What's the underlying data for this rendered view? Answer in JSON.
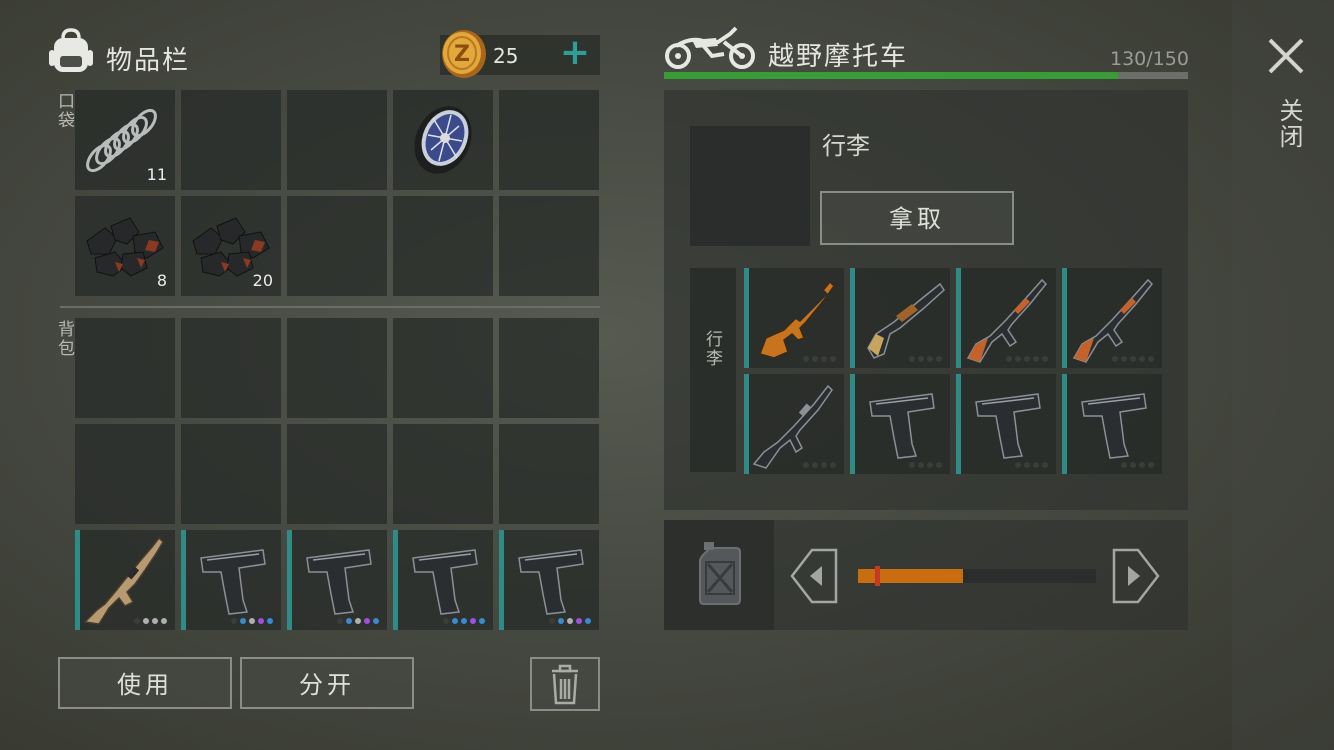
{
  "inventory": {
    "title": "物品栏",
    "coins": "25",
    "add_label": "+",
    "pocket_label": "口袋",
    "backpack_label": "背包",
    "pocket_slots": [
      {
        "icon": "spring-icon",
        "count": "11"
      },
      {
        "icon": "",
        "count": ""
      },
      {
        "icon": "",
        "count": ""
      },
      {
        "icon": "wheel-icon",
        "count": ""
      },
      {
        "icon": "",
        "count": ""
      },
      {
        "icon": "coal-icon",
        "count": "8"
      },
      {
        "icon": "coal-icon",
        "count": "20"
      },
      {
        "icon": "",
        "count": ""
      },
      {
        "icon": "",
        "count": ""
      },
      {
        "icon": "",
        "count": ""
      }
    ],
    "hotbar": [
      {
        "icon": "rifle-scar-icon",
        "dots": [
          "#3a3d3a",
          "#b0b0b0",
          "#b0b0b0",
          "#b0b0b0"
        ]
      },
      {
        "icon": "pistol-icon",
        "dots": [
          "#3a3d3a",
          "#3a8ad0",
          "#b0b0b0",
          "#a050e0",
          "#3a8ad0"
        ]
      },
      {
        "icon": "pistol-icon",
        "dots": [
          "#3a3d3a",
          "#3a8ad0",
          "#b0b0b0",
          "#a050e0",
          "#3a8ad0"
        ]
      },
      {
        "icon": "pistol-icon",
        "dots": [
          "#3a3d3a",
          "#3a8ad0",
          "#3a8ad0",
          "#a050e0",
          "#3a8ad0"
        ]
      },
      {
        "icon": "pistol-icon",
        "dots": [
          "#3a3d3a",
          "#3a8ad0",
          "#b0b0b0",
          "#a050e0",
          "#3a8ad0"
        ]
      }
    ],
    "use_label": "使用",
    "split_label": "分开"
  },
  "vehicle": {
    "title": "越野摩托车",
    "capacity_text": "130/150",
    "capacity_fraction": 0.867,
    "luggage_title": "行李",
    "take_label": "拿取",
    "luggage_side_label": "行李",
    "luggage": [
      {
        "icon": "sniper-rifle-icon"
      },
      {
        "icon": "shotgun-icon"
      },
      {
        "icon": "ak-rifle-icon"
      },
      {
        "icon": "ak-rifle-icon"
      },
      {
        "icon": "m16-rifle-icon"
      },
      {
        "icon": "pistol-icon"
      },
      {
        "icon": "pistol-icon"
      },
      {
        "icon": "pistol-icon"
      }
    ],
    "fuel_fraction": 0.44,
    "fuel_marker_fraction": 0.07
  },
  "close_label": "关闭",
  "colors": {
    "accent": "#2f8b86",
    "capacity_bar": "#3a9c36",
    "fuel_bar": "#c96e10"
  }
}
